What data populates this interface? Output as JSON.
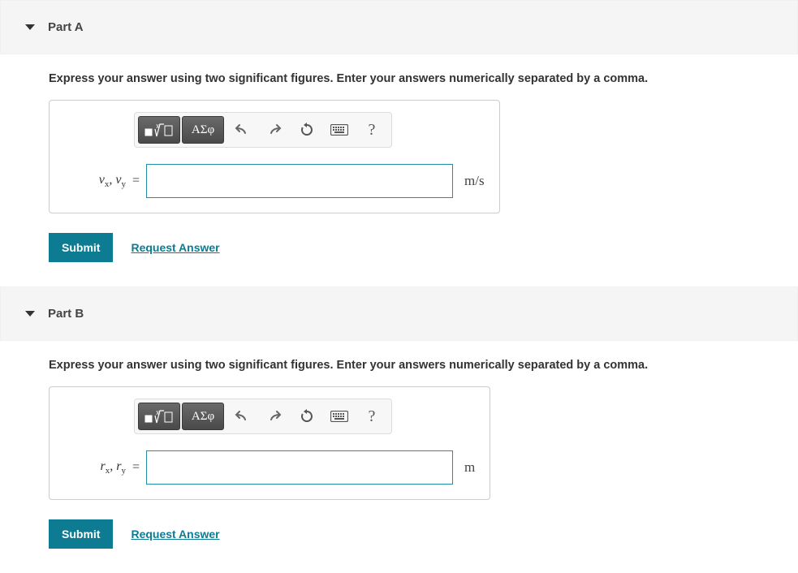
{
  "parts": [
    {
      "title": "Part A",
      "instruction": "Express your answer using two significant figures. Enter your answers numerically separated by a comma.",
      "var_html": "<i>v</i><sub>x</sub>, <i>v</i><sub>y</sub>",
      "equals": "=",
      "value": "",
      "units": "m/s",
      "submit": "Submit",
      "request": "Request Answer",
      "toolbar": {
        "greek": "ΑΣφ",
        "help": "?"
      }
    },
    {
      "title": "Part B",
      "instruction": "Express your answer using two significant figures. Enter your answers numerically separated by a comma.",
      "var_html": "<i>r</i><sub>x</sub>, <i>r</i><sub>y</sub>",
      "equals": "=",
      "value": "",
      "units": "m",
      "submit": "Submit",
      "request": "Request Answer",
      "toolbar": {
        "greek": "ΑΣφ",
        "help": "?"
      }
    }
  ]
}
